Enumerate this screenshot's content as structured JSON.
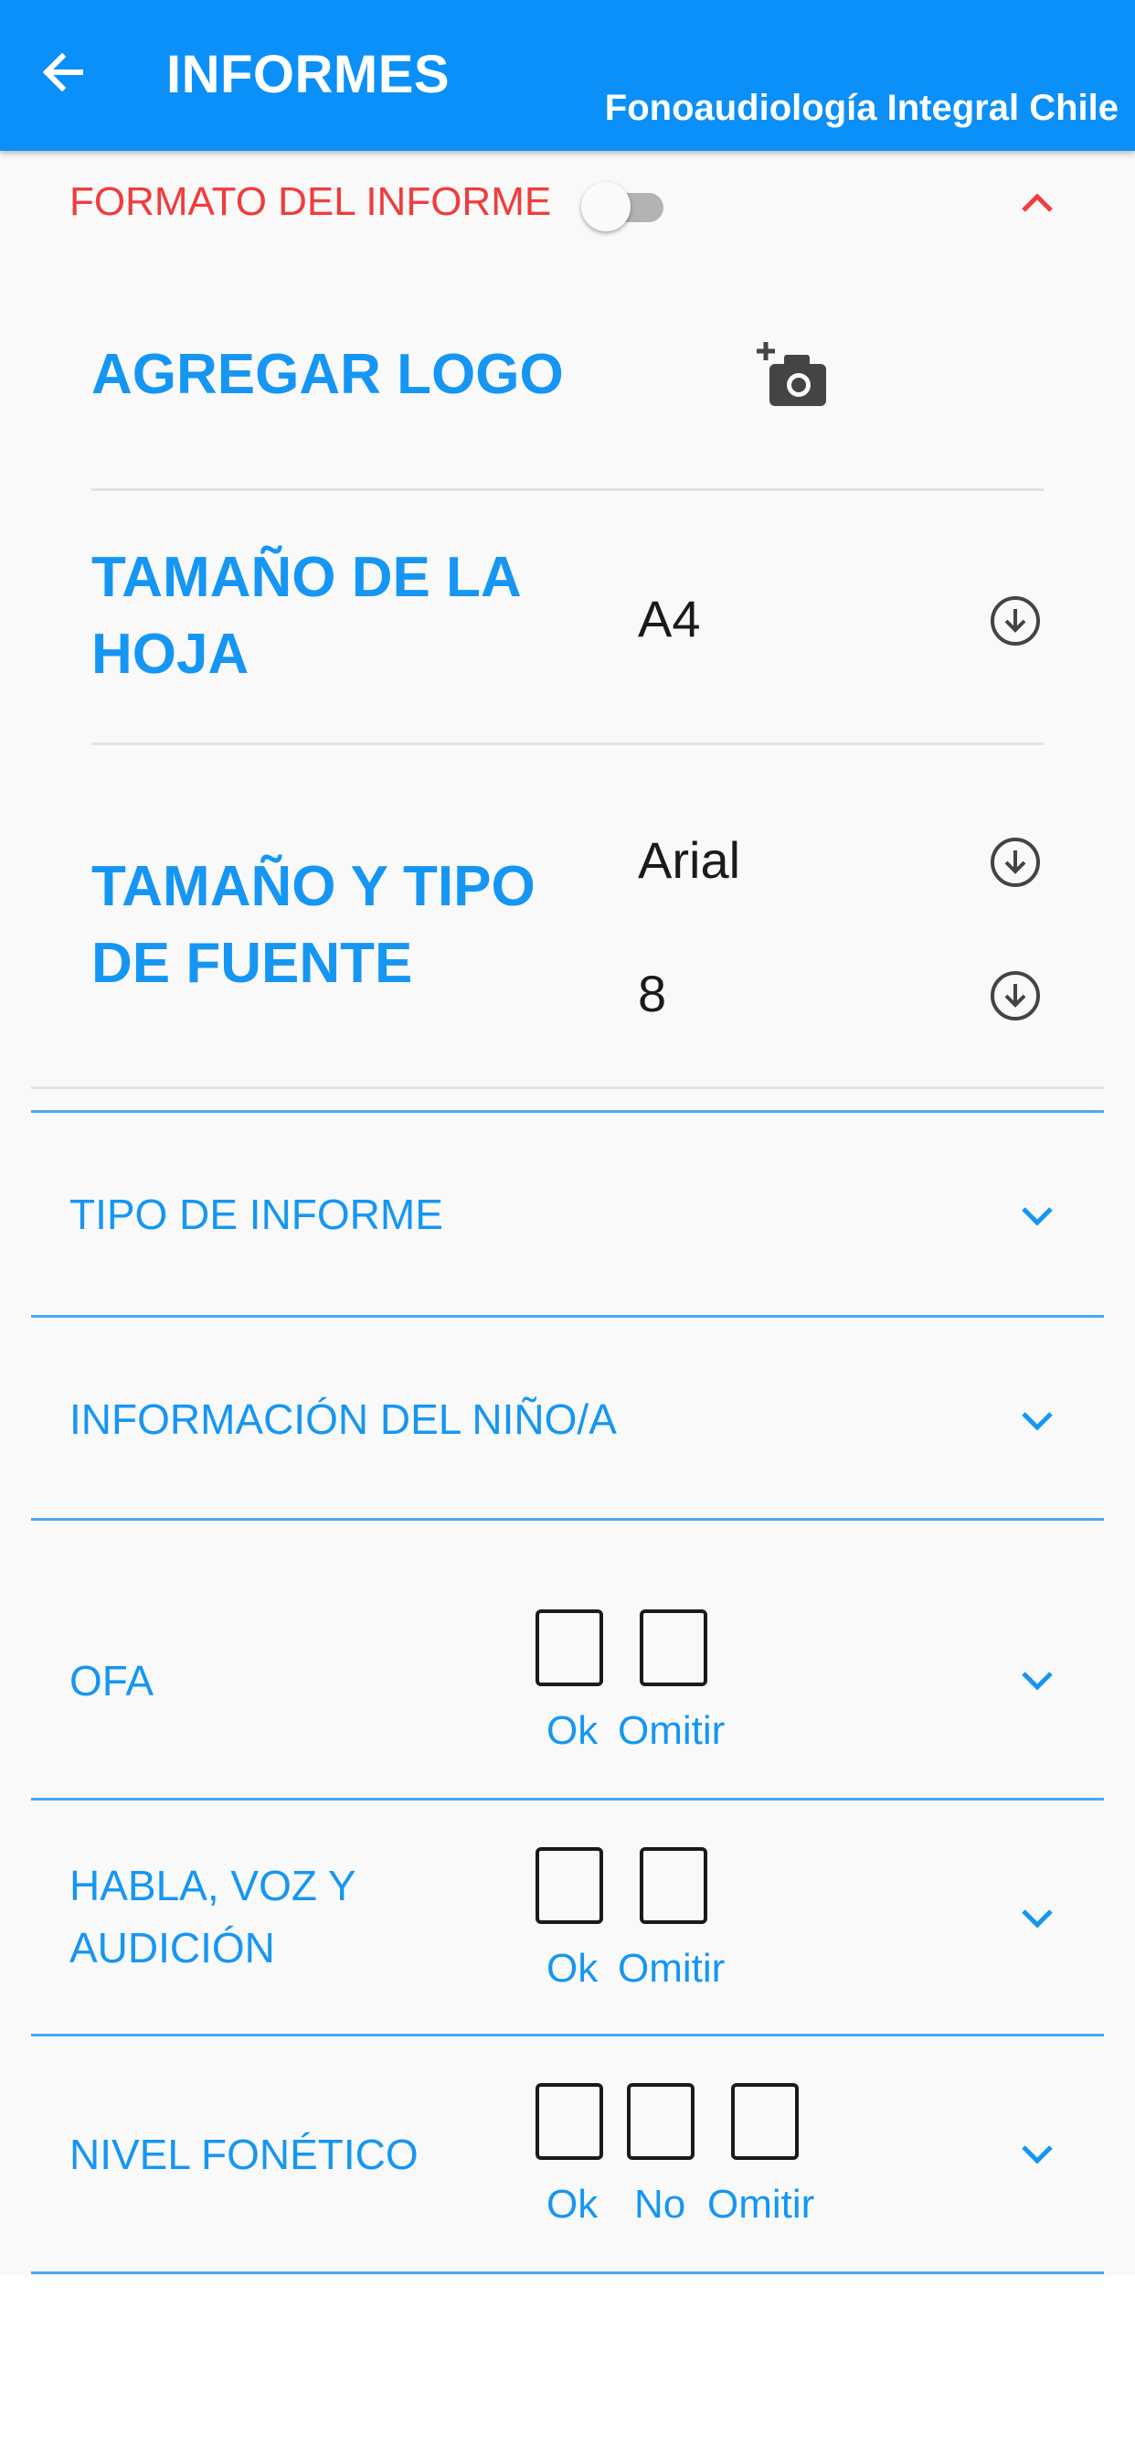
{
  "header": {
    "title": "INFORMES",
    "subtitle": "Fonoaudiología Integral Chile"
  },
  "formato": {
    "title": "FORMATO DEL INFORME",
    "toggle_on": false,
    "logo_label": "AGREGAR LOGO",
    "sheet_label_line1": "TAMAÑO DE LA",
    "sheet_label_line2": "HOJA",
    "sheet_value": "A4",
    "font_label_line1": "TAMAÑO Y TIPO",
    "font_label_line2": "DE FUENTE",
    "font_family_value": "Arial",
    "font_size_value": "8"
  },
  "sections": {
    "tipo": "TIPO DE INFORME",
    "info_nino": "INFORMACIÓN DEL NIÑO/A",
    "ofa": "OFA",
    "habla_line1": "HABLA, VOZ Y",
    "habla_line2": "AUDICIÓN",
    "nivel": "NIVEL FONÉTICO"
  },
  "checks": {
    "ok": "Ok",
    "no": "No",
    "omitir": "Omitir"
  },
  "colors": {
    "primary": "#0a90f8",
    "label_blue": "#1696f3",
    "accent_red": "#f03c3c"
  },
  "icons": [
    "arrow-back-icon",
    "chevron-up-icon",
    "add-photo-icon",
    "download-circle-icon",
    "chevron-down-icon"
  ]
}
